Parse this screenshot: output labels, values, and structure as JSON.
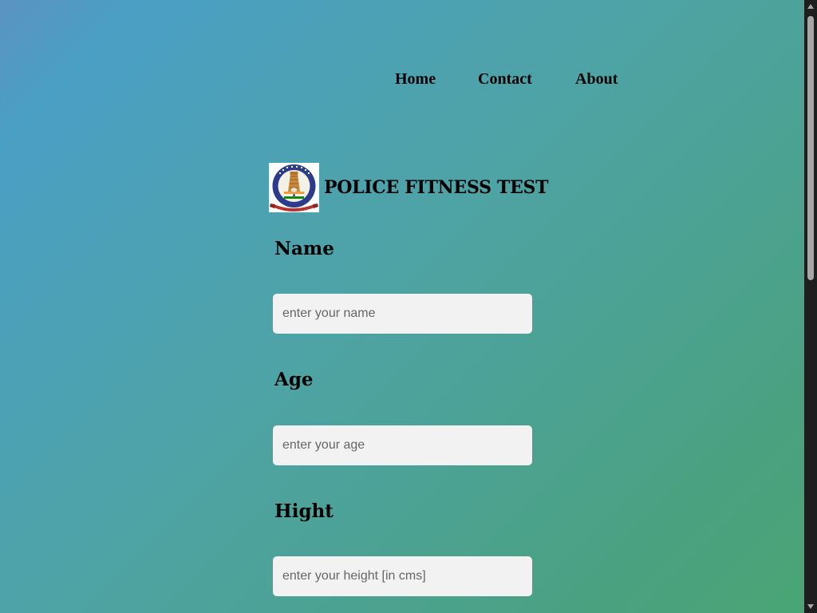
{
  "nav": {
    "items": [
      {
        "label": "Home"
      },
      {
        "label": "Contact"
      },
      {
        "label": "About"
      }
    ]
  },
  "header": {
    "logo_text_top": "TAMILNADU POLICE",
    "logo_text_bottom": "சத்யமே ஜெயதே",
    "title": "POLICE FITNESS TEST"
  },
  "form": {
    "name": {
      "label": "Name",
      "placeholder": "enter your name",
      "value": ""
    },
    "age": {
      "label": "Age",
      "placeholder": "enter your age",
      "value": ""
    },
    "height": {
      "label": "Hight",
      "placeholder": "enter your height [in cms]",
      "value": ""
    }
  },
  "colors": {
    "bg_top_left": "#4a9fc4",
    "bg_bottom_right": "#49a574",
    "input_bg": "#f2f2f2",
    "scrollbar_track": "#1e1e1e",
    "scrollbar_thumb": "#a6a6a6"
  },
  "icons": {
    "logo": "tamilnadu-police-emblem",
    "scroll_up": "triangle-up-icon",
    "scroll_down": "triangle-down-icon"
  }
}
